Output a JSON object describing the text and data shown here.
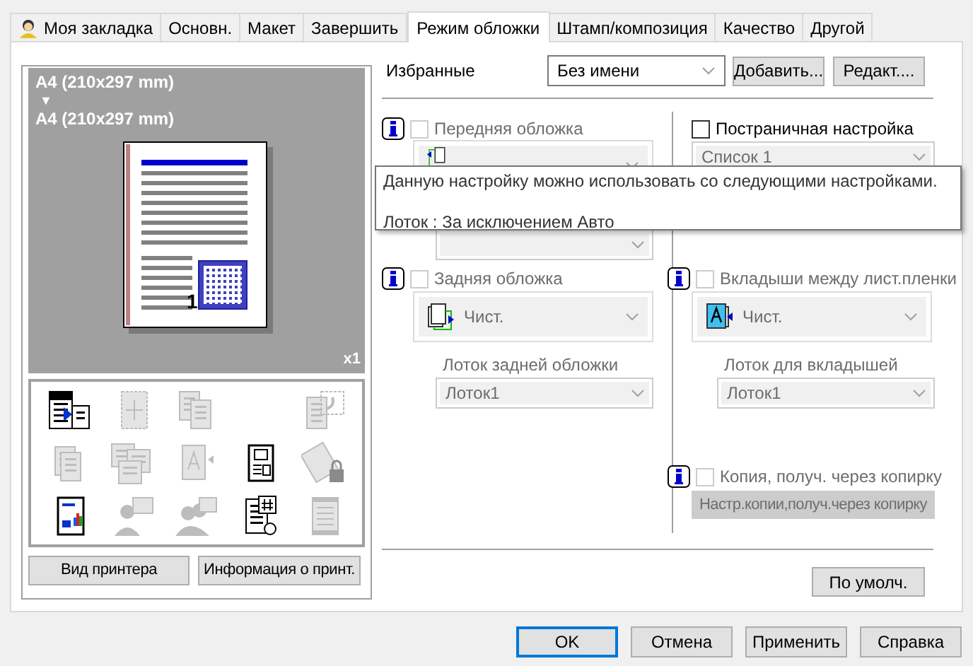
{
  "tabs": [
    {
      "label": "Моя закладка",
      "selected": false,
      "icon": true
    },
    {
      "label": "Основн.",
      "selected": false,
      "icon": false
    },
    {
      "label": "Макет",
      "selected": false,
      "icon": false
    },
    {
      "label": "Завершить",
      "selected": false,
      "icon": false
    },
    {
      "label": "Режим обложки",
      "selected": true,
      "icon": false
    },
    {
      "label": "Штамп/композиция",
      "selected": false,
      "icon": false
    },
    {
      "label": "Качество",
      "selected": false,
      "icon": false
    },
    {
      "label": "Другой",
      "selected": false,
      "icon": false
    }
  ],
  "preview": {
    "paper_from": "A4 (210x297 mm)",
    "arrow": "▼",
    "paper_to": "A4 (210x297 mm)",
    "page_number": "1",
    "copies": "x1"
  },
  "function_tiles": [
    {
      "kind": "printer",
      "enabled": true
    },
    {
      "kind": "layout",
      "enabled": false
    },
    {
      "kind": "stack",
      "enabled": false
    },
    {
      "kind": "empty"
    },
    {
      "kind": "rotate",
      "enabled": false
    },
    {
      "kind": "pages",
      "enabled": false
    },
    {
      "kind": "multi",
      "enabled": false
    },
    {
      "kind": "text-page",
      "enabled": false
    },
    {
      "kind": "form-page",
      "enabled": true
    },
    {
      "kind": "lock-page",
      "enabled": false
    },
    {
      "kind": "chart-page",
      "enabled": true
    },
    {
      "kind": "person",
      "enabled": false
    },
    {
      "kind": "people",
      "enabled": false
    },
    {
      "kind": "stamp-page",
      "enabled": true
    },
    {
      "kind": "banner",
      "enabled": false
    }
  ],
  "left_buttons": [
    "Вид принтера",
    "Информация о принт."
  ],
  "favorites": {
    "label": "Избранные",
    "value": "Без имени",
    "buttons": [
      "Добавить...",
      "Редакт...."
    ]
  },
  "front_cover": {
    "label": "Передняя обложка",
    "checked": false,
    "disabled": true
  },
  "back_cover": {
    "label": "Задняя обложка",
    "checked": false,
    "disabled": true,
    "paper": "Чист.",
    "tray_label": "Лоток задней обложки",
    "tray": "Лоток1"
  },
  "per_page": {
    "label": "Постраничная настройка",
    "checked": false,
    "disabled": false,
    "list": "Список 1"
  },
  "interleave": {
    "label": "Вкладыши между лист.пленки",
    "checked": false,
    "disabled": true,
    "paper": "Чист.",
    "tray_label": "Лоток для вкладышей",
    "tray": "Лоток1"
  },
  "carbon_copy": {
    "label": "Копия, получ. через копирку",
    "checked": false,
    "disabled": true,
    "button": "Настр.копии,получ.через копирку"
  },
  "tooltip": {
    "lines": [
      "Данную настройку можно использовать со следующими настройками.",
      "Лоток : За исключением Авто"
    ]
  },
  "default_button": "По умолч.",
  "dialog_buttons": [
    {
      "label": "OK",
      "default": true
    },
    {
      "label": "Отмена",
      "default": false
    },
    {
      "label": "Применить",
      "default": false
    },
    {
      "label": "Справка",
      "default": false
    }
  ]
}
